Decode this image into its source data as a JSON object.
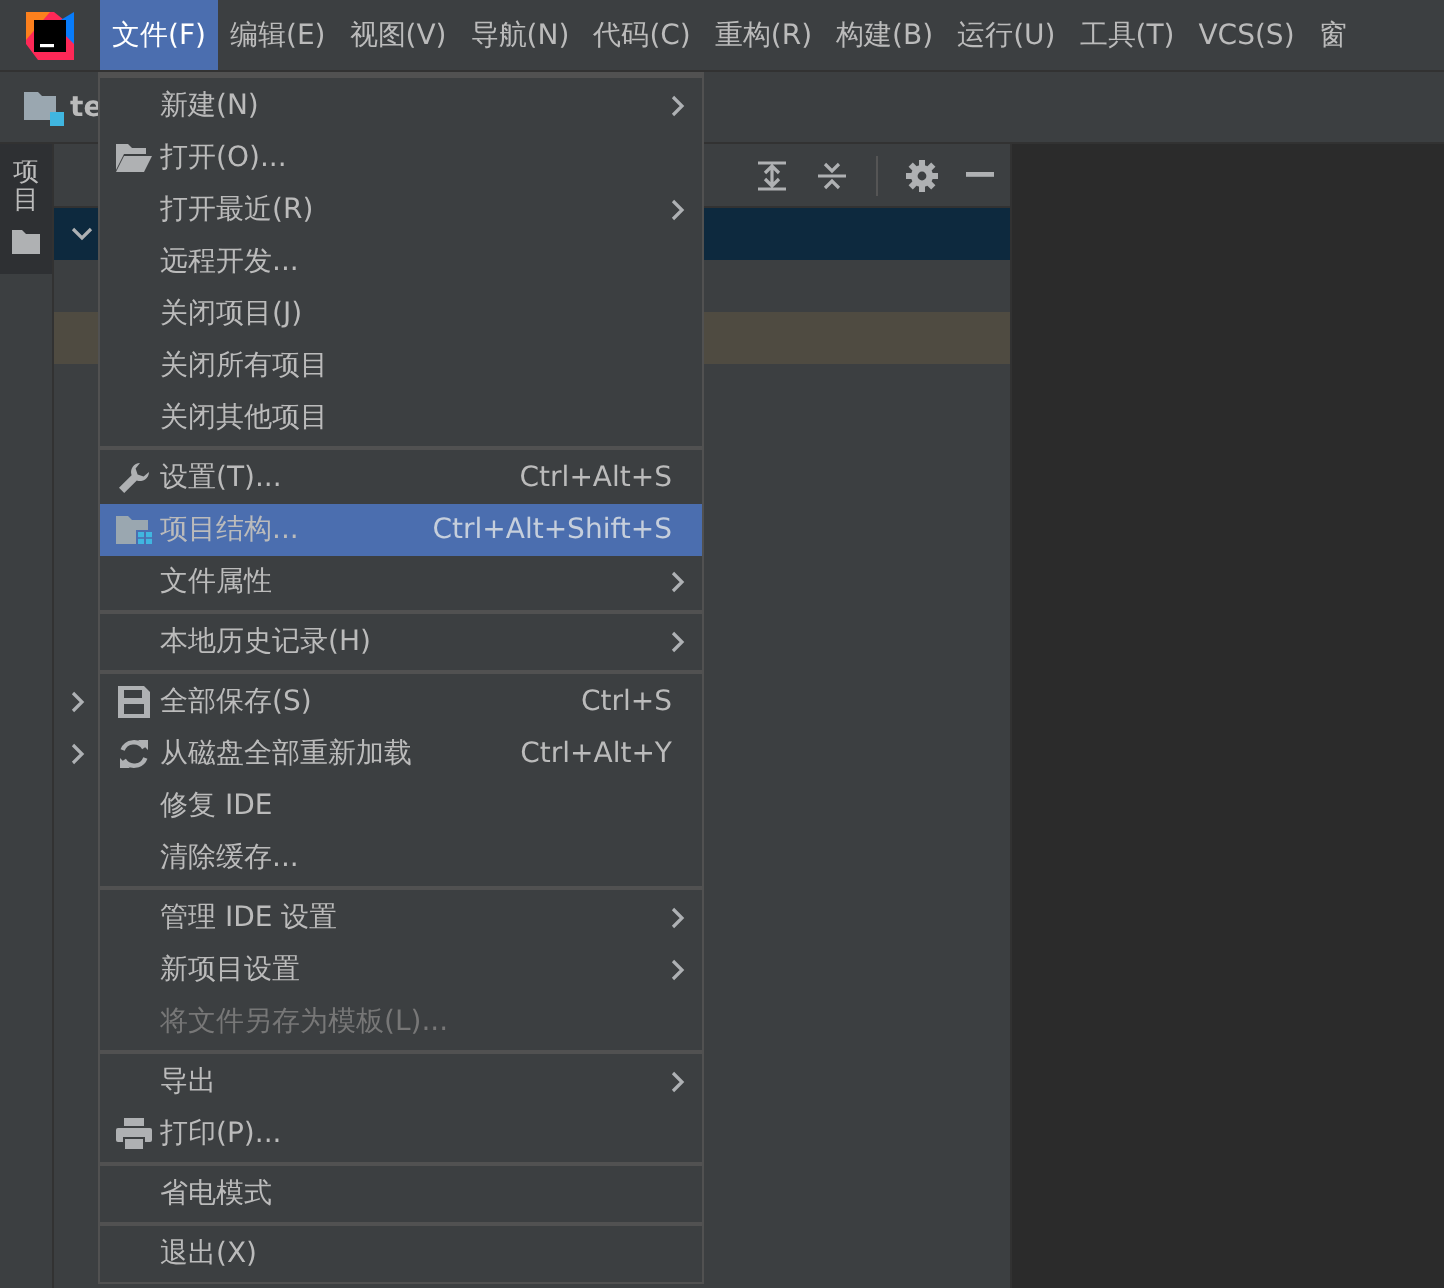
{
  "menubar": {
    "items": [
      {
        "label": "文件(F)",
        "selected": true
      },
      {
        "label": "编辑(E)",
        "selected": false
      },
      {
        "label": "视图(V)",
        "selected": false
      },
      {
        "label": "导航(N)",
        "selected": false
      },
      {
        "label": "代码(C)",
        "selected": false
      },
      {
        "label": "重构(R)",
        "selected": false
      },
      {
        "label": "构建(B)",
        "selected": false
      },
      {
        "label": "运行(U)",
        "selected": false
      },
      {
        "label": "工具(T)",
        "selected": false
      },
      {
        "label": "VCS(S)",
        "selected": false
      },
      {
        "label": "窗",
        "selected": false
      }
    ]
  },
  "navigation_bar": {
    "project": "te"
  },
  "tool_strip": {
    "tabs": [
      {
        "label": "项目",
        "selected": true
      }
    ]
  },
  "project_panel": {
    "rows": [
      {
        "kind": "plain",
        "expandable": true,
        "expanded": true,
        "selected": true
      },
      {
        "kind": "plain",
        "expandable": false,
        "selected": false
      },
      {
        "kind": "highlighted",
        "expandable": false,
        "selected": false
      },
      {
        "kind": "plain",
        "expandable": false,
        "selected": false
      },
      {
        "kind": "plain",
        "expandable": false,
        "selected": false
      },
      {
        "kind": "plain",
        "expandable": false,
        "selected": false
      },
      {
        "kind": "plain",
        "expandable": false,
        "selected": false
      },
      {
        "kind": "plain",
        "expandable": false,
        "selected": false
      },
      {
        "kind": "plain",
        "expandable": false,
        "selected": false
      },
      {
        "kind": "plain",
        "expandable": true,
        "expanded": false,
        "selected": false
      },
      {
        "kind": "plain",
        "expandable": true,
        "expanded": false,
        "selected": false
      }
    ]
  },
  "file_menu": {
    "sections": [
      {
        "items": [
          {
            "kind": "plain",
            "label": "新建(N)",
            "submenu": true,
            "selected": false,
            "disabled": false
          },
          {
            "kind": "open",
            "label": "打开(O)...",
            "submenu": false,
            "selected": false,
            "disabled": false
          },
          {
            "kind": "plain",
            "label": "打开最近(R)",
            "submenu": true,
            "selected": false,
            "disabled": false
          },
          {
            "kind": "plain",
            "label": "远程开发...",
            "submenu": false,
            "selected": false,
            "disabled": false
          },
          {
            "kind": "plain",
            "label": "关闭项目(J)",
            "submenu": false,
            "selected": false,
            "disabled": false
          },
          {
            "kind": "plain",
            "label": "关闭所有项目",
            "submenu": false,
            "selected": false,
            "disabled": false
          },
          {
            "kind": "plain",
            "label": "关闭其他项目",
            "submenu": false,
            "selected": false,
            "disabled": false
          }
        ]
      },
      {
        "items": [
          {
            "kind": "settings",
            "label": "设置(T)...",
            "shortcut": "Ctrl+Alt+S",
            "submenu": false,
            "selected": false,
            "disabled": false
          },
          {
            "kind": "structure",
            "label": "项目结构...",
            "shortcut": "Ctrl+Alt+Shift+S",
            "submenu": false,
            "selected": true,
            "disabled": false
          },
          {
            "kind": "plain",
            "label": "文件属性",
            "submenu": true,
            "selected": false,
            "disabled": false
          }
        ]
      },
      {
        "items": [
          {
            "kind": "plain",
            "label": "本地历史记录(H)",
            "submenu": true,
            "selected": false,
            "disabled": false
          }
        ]
      },
      {
        "items": [
          {
            "kind": "save",
            "label": "全部保存(S)",
            "shortcut": "Ctrl+S",
            "submenu": false,
            "selected": false,
            "disabled": false
          },
          {
            "kind": "reload",
            "label": "从磁盘全部重新加载",
            "shortcut": "Ctrl+Alt+Y",
            "submenu": false,
            "selected": false,
            "disabled": false
          },
          {
            "kind": "plain",
            "label": "修复 IDE",
            "submenu": false,
            "selected": false,
            "disabled": false
          },
          {
            "kind": "plain",
            "label": "清除缓存...",
            "submenu": false,
            "selected": false,
            "disabled": false
          }
        ]
      },
      {
        "items": [
          {
            "kind": "plain",
            "label": "管理 IDE 设置",
            "submenu": true,
            "selected": false,
            "disabled": false
          },
          {
            "kind": "plain",
            "label": "新项目设置",
            "submenu": true,
            "selected": false,
            "disabled": false
          },
          {
            "kind": "plain",
            "label": "将文件另存为模板(L)...",
            "submenu": false,
            "selected": false,
            "disabled": true
          }
        ]
      },
      {
        "items": [
          {
            "kind": "plain",
            "label": "导出",
            "submenu": true,
            "selected": false,
            "disabled": false
          },
          {
            "kind": "print",
            "label": "打印(P)...",
            "submenu": false,
            "selected": false,
            "disabled": false
          }
        ]
      },
      {
        "items": [
          {
            "kind": "plain",
            "label": "省电模式",
            "submenu": false,
            "selected": false,
            "disabled": false
          }
        ]
      },
      {
        "items": [
          {
            "kind": "plain",
            "label": "退出(X)",
            "submenu": false,
            "selected": false,
            "disabled": false
          }
        ]
      }
    ]
  }
}
